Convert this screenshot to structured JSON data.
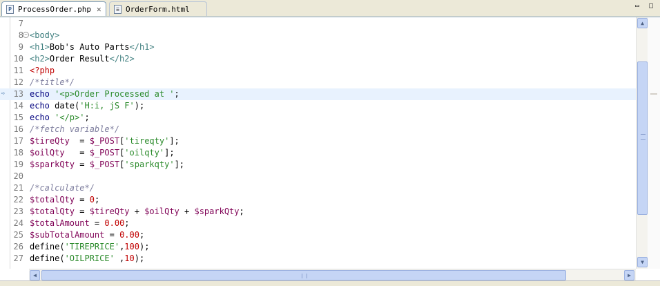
{
  "tabs": [
    {
      "label": "ProcessOrder.php",
      "icon": "php-file-icon",
      "active": true
    },
    {
      "label": "OrderForm.html",
      "icon": "html-file-icon",
      "active": false
    }
  ],
  "window_controls": {
    "minimize": "▭",
    "maximize": "□"
  },
  "editor": {
    "current_line": 13,
    "lines": [
      {
        "n": "7",
        "tokens": []
      },
      {
        "n": "8",
        "fold": "−",
        "tokens": [
          {
            "c": "tag",
            "t": "<body>"
          }
        ]
      },
      {
        "n": "9",
        "tokens": [
          {
            "c": "tag",
            "t": "<h1>"
          },
          {
            "c": "txt",
            "t": "Bob's Auto Parts"
          },
          {
            "c": "tag",
            "t": "</h1>"
          }
        ]
      },
      {
        "n": "10",
        "tokens": [
          {
            "c": "tag",
            "t": "<h2>"
          },
          {
            "c": "txt",
            "t": "Order Result"
          },
          {
            "c": "tag",
            "t": "</h2>"
          }
        ]
      },
      {
        "n": "11",
        "tokens": [
          {
            "c": "php",
            "t": "<?php"
          }
        ]
      },
      {
        "n": "12",
        "tokens": [
          {
            "c": "cmt",
            "t": "/*title*/"
          }
        ]
      },
      {
        "n": "13",
        "tokens": [
          {
            "c": "kw",
            "t": "echo "
          },
          {
            "c": "str",
            "t": "'<p>Order Processed at '"
          },
          {
            "c": "op",
            "t": ";"
          }
        ]
      },
      {
        "n": "14",
        "tokens": [
          {
            "c": "kw",
            "t": "echo "
          },
          {
            "c": "op",
            "t": "date("
          },
          {
            "c": "str",
            "t": "'H:i, jS F'"
          },
          {
            "c": "op",
            "t": ");"
          }
        ]
      },
      {
        "n": "15",
        "tokens": [
          {
            "c": "kw",
            "t": "echo "
          },
          {
            "c": "str",
            "t": "'</p>'"
          },
          {
            "c": "op",
            "t": ";"
          }
        ]
      },
      {
        "n": "16",
        "tokens": [
          {
            "c": "cmt",
            "t": "/*fetch variable*/"
          }
        ]
      },
      {
        "n": "17",
        "tokens": [
          {
            "c": "var",
            "t": "$tireQty"
          },
          {
            "c": "op",
            "t": "  = "
          },
          {
            "c": "var",
            "t": "$_POST"
          },
          {
            "c": "op",
            "t": "["
          },
          {
            "c": "str",
            "t": "'tireqty'"
          },
          {
            "c": "op",
            "t": "];"
          }
        ]
      },
      {
        "n": "18",
        "tokens": [
          {
            "c": "var",
            "t": "$oilQty"
          },
          {
            "c": "op",
            "t": "   = "
          },
          {
            "c": "var",
            "t": "$_POST"
          },
          {
            "c": "op",
            "t": "["
          },
          {
            "c": "str",
            "t": "'oilqty'"
          },
          {
            "c": "op",
            "t": "];"
          }
        ]
      },
      {
        "n": "19",
        "tokens": [
          {
            "c": "var",
            "t": "$sparkQty"
          },
          {
            "c": "op",
            "t": " = "
          },
          {
            "c": "var",
            "t": "$_POST"
          },
          {
            "c": "op",
            "t": "["
          },
          {
            "c": "str",
            "t": "'sparkqty'"
          },
          {
            "c": "op",
            "t": "];"
          }
        ]
      },
      {
        "n": "20",
        "tokens": []
      },
      {
        "n": "21",
        "tokens": [
          {
            "c": "cmt",
            "t": "/*calculate*/"
          }
        ]
      },
      {
        "n": "22",
        "tokens": [
          {
            "c": "var",
            "t": "$totalQty"
          },
          {
            "c": "op",
            "t": " = "
          },
          {
            "c": "num",
            "t": "0"
          },
          {
            "c": "op",
            "t": ";"
          }
        ]
      },
      {
        "n": "23",
        "tokens": [
          {
            "c": "var",
            "t": "$totalQty"
          },
          {
            "c": "op",
            "t": " = "
          },
          {
            "c": "var",
            "t": "$tireQty"
          },
          {
            "c": "op",
            "t": " + "
          },
          {
            "c": "var",
            "t": "$oilQty"
          },
          {
            "c": "op",
            "t": " + "
          },
          {
            "c": "var",
            "t": "$sparkQty"
          },
          {
            "c": "op",
            "t": ";"
          }
        ]
      },
      {
        "n": "24",
        "tokens": [
          {
            "c": "var",
            "t": "$totalAmount"
          },
          {
            "c": "op",
            "t": " = "
          },
          {
            "c": "num",
            "t": "0.00"
          },
          {
            "c": "op",
            "t": ";"
          }
        ]
      },
      {
        "n": "25",
        "tokens": [
          {
            "c": "var",
            "t": "$subTotalAmount"
          },
          {
            "c": "op",
            "t": " = "
          },
          {
            "c": "num",
            "t": "0.00"
          },
          {
            "c": "op",
            "t": ";"
          }
        ]
      },
      {
        "n": "26",
        "tokens": [
          {
            "c": "op",
            "t": "define("
          },
          {
            "c": "str",
            "t": "'TIREPRICE'"
          },
          {
            "c": "op",
            "t": ","
          },
          {
            "c": "num",
            "t": "100"
          },
          {
            "c": "op",
            "t": ");"
          }
        ]
      },
      {
        "n": "27",
        "tokens": [
          {
            "c": "op",
            "t": "define("
          },
          {
            "c": "str",
            "t": "'OILPRICE'"
          },
          {
            "c": "op",
            "t": " ,"
          },
          {
            "c": "num",
            "t": "10"
          },
          {
            "c": "op",
            "t": ");"
          }
        ]
      }
    ]
  },
  "scroll_icons": {
    "up": "▲",
    "down": "▼",
    "left": "◀",
    "right": "▶"
  }
}
